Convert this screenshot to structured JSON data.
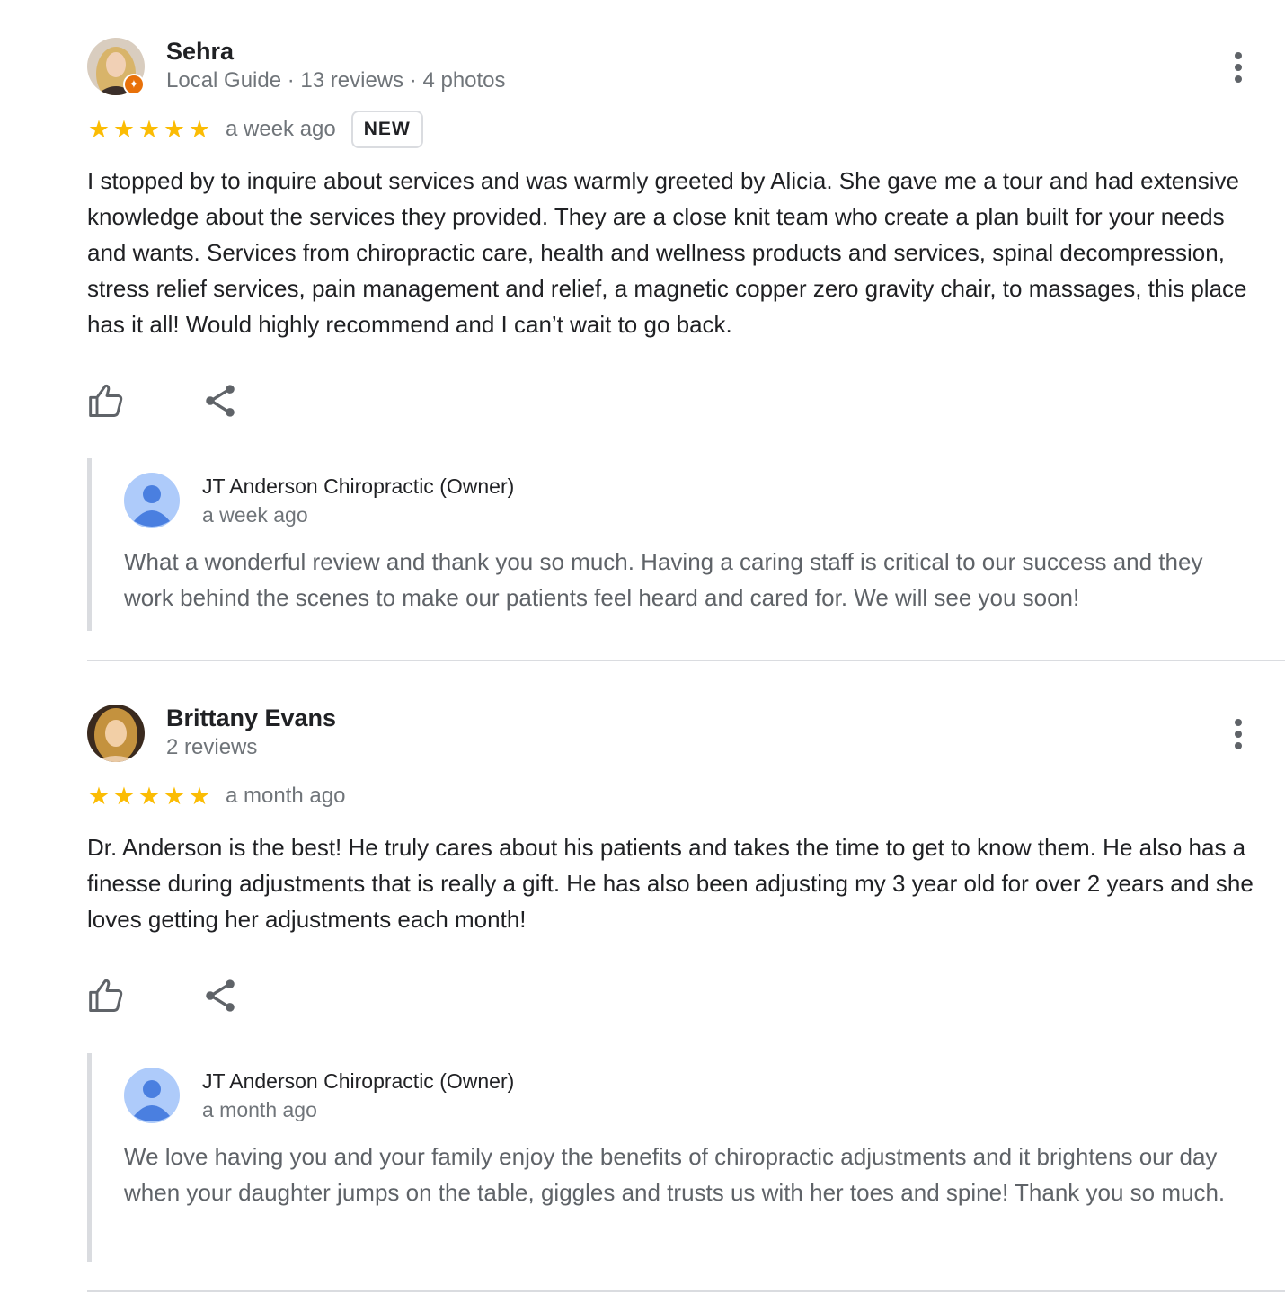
{
  "reviews": [
    {
      "name": "Sehra",
      "meta": "Local Guide · 13 reviews · 4 photos",
      "rating": 5,
      "date": "a week ago",
      "badge": "NEW",
      "text": "I stopped by to inquire about services and was warmly greeted by Alicia. She gave me a tour and had extensive knowledge about the services they provided. They are a close knit team who create a plan built for your needs and wants. Services from chiropractic care, health and wellness products and services, spinal decompression, stress relief services, pain management and relief, a magnetic copper zero gravity chair, to massages, this place has it all! Would highly recommend and I can’t wait to go back.",
      "reply": {
        "owner": "JT Anderson Chiropractic (Owner)",
        "date": "a week ago",
        "text": "What a wonderful review and thank you so much. Having a caring staff is critical to our success and they work behind the scenes to make our patients feel heard and cared for. We will see you soon!"
      }
    },
    {
      "name": "Brittany Evans",
      "meta": "2 reviews",
      "rating": 5,
      "date": "a month ago",
      "text": "Dr. Anderson is the best! He truly cares about his patients and takes the time to get to know them. He also has a finesse during adjustments that is really a gift. He has also been adjusting my 3 year old for over 2 years and she loves getting her adjustments each month!",
      "reply": {
        "owner": "JT Anderson Chiropractic (Owner)",
        "date": "a month ago",
        "text": "We love having you and your family enjoy the benefits of chiropractic adjustments and it brightens our day when your daughter jumps on the table, giggles and trusts us with her toes and spine! Thank you so much."
      }
    }
  ],
  "icons": {
    "star": "★",
    "like": "thumb-up-icon",
    "share": "share-icon",
    "more": "more-vert-icon",
    "local_guide": "local-guide-badge-icon"
  },
  "colors": {
    "star": "#fbbc04",
    "local_guide_badge": "#e8710a",
    "owner_avatar_bg": "#aecbfa",
    "owner_avatar_fg": "#4a7fe0",
    "reply_border": "#dadce0"
  }
}
